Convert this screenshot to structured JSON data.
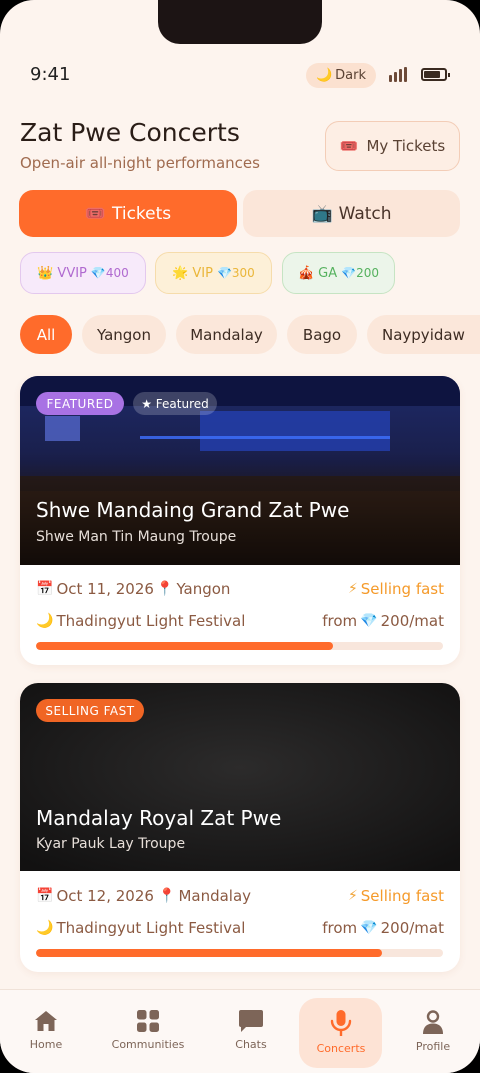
{
  "status": {
    "time": "9:41",
    "theme_toggle": {
      "icon": "🌙",
      "label": "Dark"
    }
  },
  "header": {
    "title": "Zat Pwe Concerts",
    "subtitle": "Open-air all-night performances",
    "my_tickets": {
      "icon": "🎟️",
      "label": "My Tickets"
    }
  },
  "tabs": [
    {
      "icon": "🎟️",
      "label": "Tickets",
      "active": true
    },
    {
      "icon": "📺",
      "label": "Watch",
      "active": false
    }
  ],
  "tiers": [
    {
      "icon": "👑",
      "name": "VVIP",
      "gem": "💎",
      "price": "400",
      "color": "#b06ad0"
    },
    {
      "icon": "🌟",
      "name": "VIP",
      "gem": "💎",
      "price": "300",
      "color": "#eab63a"
    },
    {
      "icon": "🎪",
      "name": "GA",
      "gem": "💎",
      "price": "200",
      "color": "#56b25f"
    }
  ],
  "city_filters": [
    "All",
    "Yangon",
    "Mandalay",
    "Bago",
    "Naypyidaw"
  ],
  "events": [
    {
      "badges": [
        "FEATURED",
        "★ Featured"
      ],
      "title": "Shwe Mandaing Grand Zat Pwe",
      "troupe": "Shwe Man Tin Maung Troupe",
      "date_icon": "📅",
      "date": "Oct 11, 2026",
      "city_icon": "📍",
      "city": "Yangon",
      "status_icon": "⚡",
      "status": "Selling fast",
      "festival_icon": "🌙",
      "festival": "Thadingyut Light Festival",
      "price_prefix": "from",
      "gem": "💎",
      "price": "200/mat",
      "sold_fraction": 0.73
    },
    {
      "badges": [
        "SELLING FAST"
      ],
      "title": "Mandalay Royal Zat Pwe",
      "troupe": "Kyar Pauk Lay Troupe",
      "date_icon": "📅",
      "date": "Oct 12, 2026",
      "city_icon": "📍",
      "city": "Mandalay",
      "status_icon": "⚡",
      "status": "Selling fast",
      "festival_icon": "🌙",
      "festival": "Thadingyut Light Festival",
      "price_prefix": "from",
      "gem": "💎",
      "price": "200/mat",
      "sold_fraction": 0.85
    }
  ],
  "nav": [
    {
      "label": "Home",
      "icon": "home-icon",
      "active": false
    },
    {
      "label": "Communities",
      "icon": "grid-icon",
      "active": false
    },
    {
      "label": "Chats",
      "icon": "chat-icon",
      "active": false
    },
    {
      "label": "Concerts",
      "icon": "microphone-icon",
      "active": true
    },
    {
      "label": "Profile",
      "icon": "user-icon",
      "active": false
    }
  ],
  "colors": {
    "accent": "#ff6b2b",
    "background": "#fdf4ee",
    "featured": "#a872e4",
    "selling": "#f06524"
  }
}
